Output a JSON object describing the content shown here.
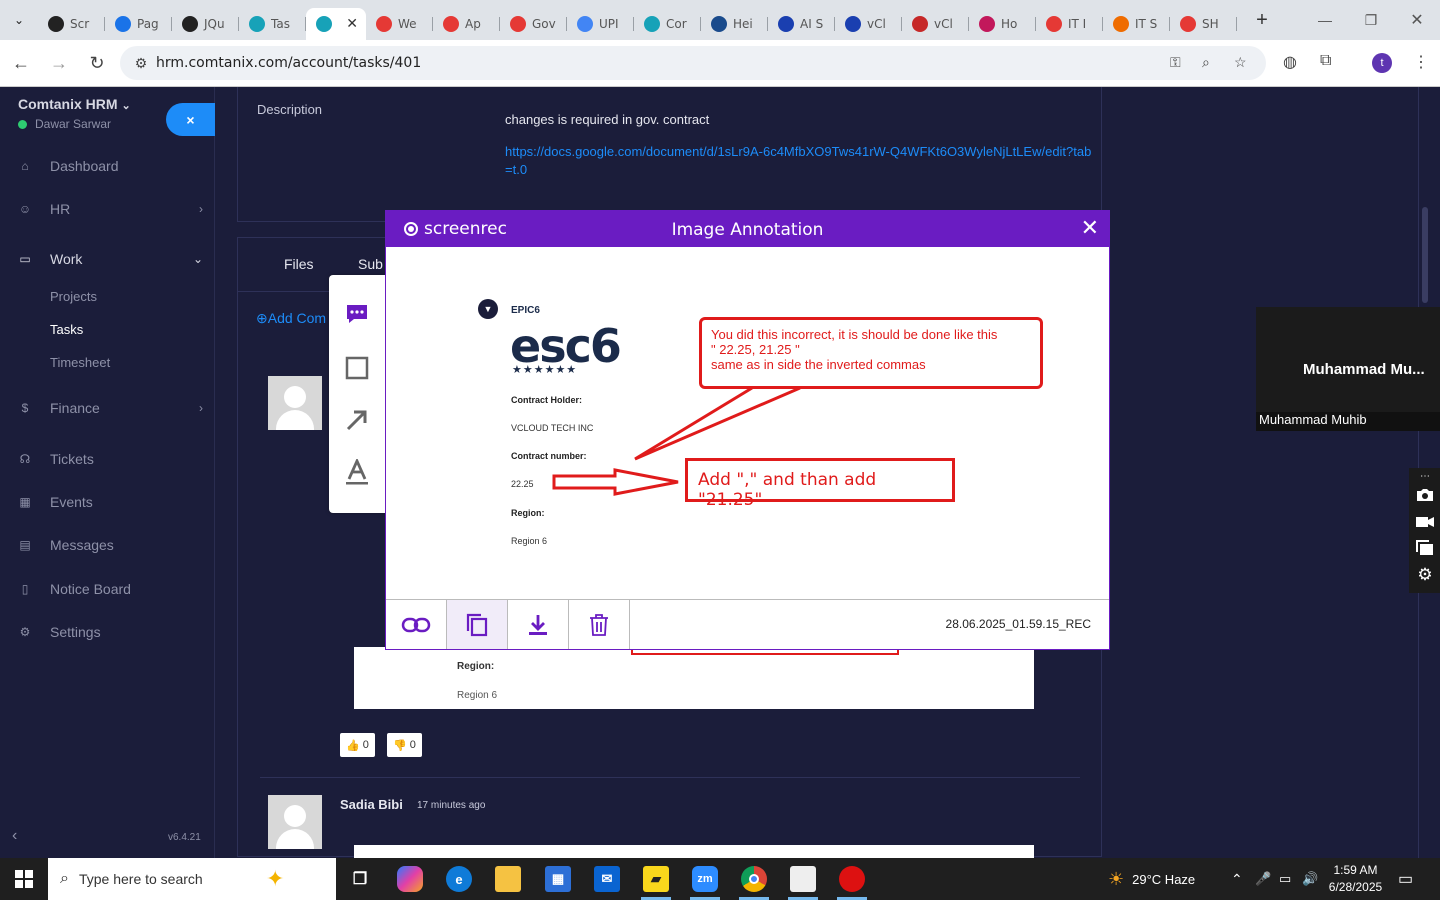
{
  "browser": {
    "tabs": [
      {
        "label": "Scr",
        "icon": "github-icon",
        "color": "#222"
      },
      {
        "label": "Pag",
        "icon": "pagespeed-icon",
        "color": "#1a73e8"
      },
      {
        "label": "JQu",
        "icon": "target-icon",
        "color": "#222"
      },
      {
        "label": "Tas",
        "icon": "hexagon-icon",
        "color": "#17a2b8"
      },
      {
        "label": "",
        "icon": "hexagon-icon",
        "color": "#17a2b8",
        "active": true
      },
      {
        "label": "We",
        "icon": "diamond-icon",
        "color": "#e53935"
      },
      {
        "label": "Ap",
        "icon": "diamond-icon",
        "color": "#e53935"
      },
      {
        "label": "Gov",
        "icon": "diamond-icon",
        "color": "#e53935"
      },
      {
        "label": "UPI",
        "icon": "docs-icon",
        "color": "#4285f4"
      },
      {
        "label": "Cor",
        "icon": "hexagon-icon",
        "color": "#17a2b8"
      },
      {
        "label": "Hei",
        "icon": "scale-icon",
        "color": "#1a4b8c"
      },
      {
        "label": "AI S",
        "icon": "x-icon",
        "color": "#1a3fb0"
      },
      {
        "label": "vCl",
        "icon": "check-icon",
        "color": "#1a3fb0"
      },
      {
        "label": "vCl",
        "icon": "v-icon",
        "color": "#c62828"
      },
      {
        "label": "Ho",
        "icon": "ball-icon",
        "color": "#c2185b"
      },
      {
        "label": "IT I",
        "icon": "diamond-icon",
        "color": "#e53935"
      },
      {
        "label": "IT S",
        "icon": "slash-icon",
        "color": "#ef6c00"
      },
      {
        "label": "SH",
        "icon": "ring-icon",
        "color": "#e53935"
      }
    ],
    "active_tab_close": "✕",
    "url": "hrm.comtanix.com/account/tasks/401"
  },
  "sidebar": {
    "brand": "Comtanix HRM",
    "user": "Dawar Sarwar",
    "close_label": "×",
    "items": [
      {
        "label": "Dashboard",
        "icon": "home-icon"
      },
      {
        "label": "HR",
        "icon": "users-icon"
      },
      {
        "label": "Work",
        "icon": "briefcase-icon"
      },
      {
        "label": "Finance",
        "icon": "dollar-icon"
      },
      {
        "label": "Tickets",
        "icon": "headset-icon"
      },
      {
        "label": "Events",
        "icon": "calendar-icon"
      },
      {
        "label": "Messages",
        "icon": "message-icon"
      },
      {
        "label": "Notice Board",
        "icon": "clipboard-icon"
      },
      {
        "label": "Settings",
        "icon": "gear-icon"
      }
    ],
    "work_sub": [
      "Projects",
      "Tasks",
      "Timesheet"
    ],
    "version": "v6.4.21"
  },
  "task": {
    "description_label": "Description",
    "description_text": "changes is required in gov. contract",
    "description_link": "https://docs.google.com/document/d/1sLr9A-6c4MfbXO9Tws41rW-Q4WFKt6O3WyleNjLtLEw/edit?tab=t.0",
    "tabs": [
      "Files",
      "Sub"
    ],
    "add_comment": "Add Com",
    "comment_shot": {
      "region_label": "Region:",
      "region_value": "Region 6"
    },
    "likes": "0",
    "dislikes": "0",
    "next_comment": {
      "author": "Sadia Bibi",
      "ago": "17 minutes ago"
    }
  },
  "annotation_tool": {
    "brand": "screenrec",
    "title": "Image Annotation",
    "close": "✕",
    "doc": {
      "section": "EPIC6",
      "logo": "esc6",
      "stars": "★★★★★★",
      "holder_label": "Contract Holder:",
      "holder_value": "VCLOUD TECH INC",
      "number_label": "Contract number:",
      "number_value": "22.25",
      "region_label": "Region:",
      "region_value": "Region 6"
    },
    "note1": [
      "You did this incorrect, it is should be done like this",
      "\" 22.25, 21.25 \"",
      "same as in side the inverted commas"
    ],
    "note2": "Add \",\" and than add \"21.25\"",
    "filename": "28.06.2025_01.59.15_REC",
    "accent": "#6a1cc2",
    "annotation_color": "#e01b1b"
  },
  "video": {
    "name": "Muhammad  Mu...",
    "label": "Muhammad Muhib"
  },
  "taskbar": {
    "search_placeholder": "Type here to search",
    "weather": "29°C  Haze",
    "time": "1:59 AM",
    "date": "6/28/2025"
  }
}
